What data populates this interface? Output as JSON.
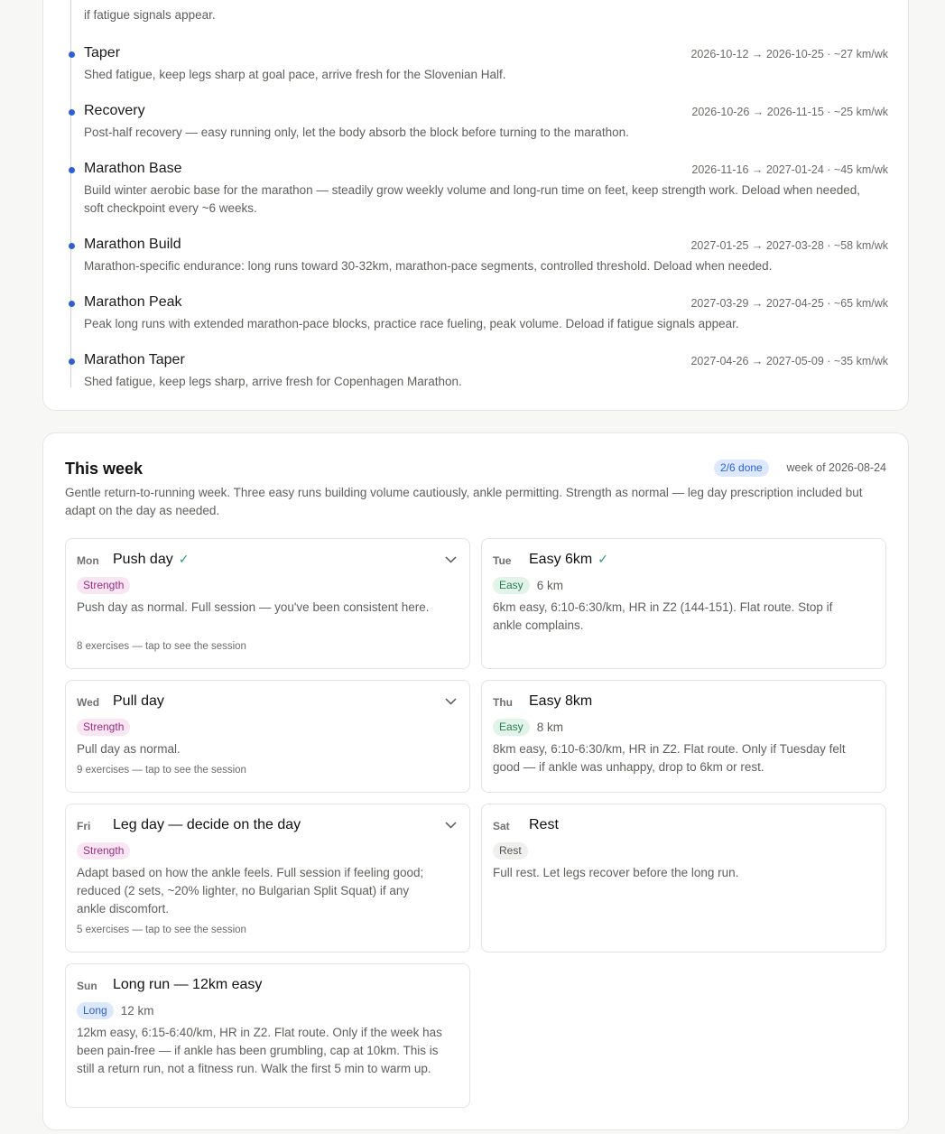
{
  "phases": {
    "fragment_text": "if fatigue signals appear.",
    "items": [
      {
        "name": "Taper",
        "meta": "2026-10-12 → 2026-10-25 · ~27 km/wk",
        "desc": "Shed fatigue, keep legs sharp at goal pace, arrive fresh for the Slovenian Half."
      },
      {
        "name": "Recovery",
        "meta": "2026-10-26 → 2026-11-15 · ~25 km/wk",
        "desc": "Post-half recovery — easy running only, let the body absorb the block before turning to the marathon."
      },
      {
        "name": "Marathon Base",
        "meta": "2026-11-16 → 2027-01-24 · ~45 km/wk",
        "desc": "Build winter aerobic base for the marathon — steadily grow weekly volume and long-run time on feet, keep strength work. Deload when needed, soft checkpoint every ~6 weeks."
      },
      {
        "name": "Marathon Build",
        "meta": "2027-01-25 → 2027-03-28 · ~58 km/wk",
        "desc": "Marathon-specific endurance: long runs toward 30-32km, marathon-pace segments, controlled threshold. Deload when needed."
      },
      {
        "name": "Marathon Peak",
        "meta": "2027-03-29 → 2027-04-25 · ~65 km/wk",
        "desc": "Peak long runs with extended marathon-pace blocks, practice race fueling, peak volume. Deload if fatigue signals appear."
      },
      {
        "name": "Marathon Taper",
        "meta": "2027-04-26 → 2027-05-09 · ~35 km/wk",
        "desc": "Shed fatigue, keep legs sharp, arrive fresh for Copenhagen Marathon."
      }
    ]
  },
  "week": {
    "title": "This week",
    "done_badge": "2/6 done",
    "week_of": "week of 2026-08-24",
    "desc": "Gentle return-to-running week. Three easy runs building volume cautiously, ankle permitting. Strength as normal — leg day prescription included but adapt on the day as needed.",
    "days": [
      {
        "day": "Mon",
        "title": "Push day",
        "done": true,
        "check": "✓",
        "tag": "Strength",
        "desc": "Push day as normal. Full session — you've been consistent here.",
        "foot": "8 exercises — tap to see the session"
      },
      {
        "day": "Tue",
        "title": "Easy 6km",
        "done": true,
        "check": "✓",
        "tag": "Easy",
        "distance": "6 km",
        "desc": "6km easy, 6:10-6:30/km, HR in Z2 (144-151). Flat route. Stop if ankle complains."
      },
      {
        "day": "Wed",
        "title": "Pull day",
        "tag": "Strength",
        "desc": "Pull day as normal.",
        "foot": "9 exercises — tap to see the session"
      },
      {
        "day": "Thu",
        "title": "Easy 8km",
        "tag": "Easy",
        "distance": "8 km",
        "desc": "8km easy, 6:10-6:30/km, HR in Z2. Flat route. Only if Tuesday felt good — if ankle was unhappy, drop to 6km or rest."
      },
      {
        "day": "Fri",
        "title": "Leg day — decide on the day",
        "tag": "Strength",
        "desc": "Adapt based on how the ankle feels. Full session if feeling good; reduced (2 sets, ~20% lighter, no Bulgarian Split Squat) if any ankle discomfort.",
        "foot": "5 exercises — tap to see the session"
      },
      {
        "day": "Sat",
        "title": "Rest",
        "tag": "Rest",
        "desc": "Full rest. Let legs recover before the long run."
      },
      {
        "day": "Sun",
        "title": "Long run — 12km easy",
        "tag": "Long",
        "distance": "12 km",
        "desc": "12km easy, 6:15-6:40/km, HR in Z2. Flat route. Only if the week has been pain-free — if ankle has been grumbling, cap at 10km. This is still a return run, not a fitness run. Walk the first 5 min to warm up."
      }
    ]
  },
  "colors": {
    "accent": "#2f5fd6",
    "check": "#2f9e6a",
    "strength_tag": "#9b2d80",
    "easy_tag": "#2a8055"
  },
  "icons": {
    "expand": "chevron-down-icon",
    "done": "check-icon",
    "phase_marker": "dot-icon"
  }
}
